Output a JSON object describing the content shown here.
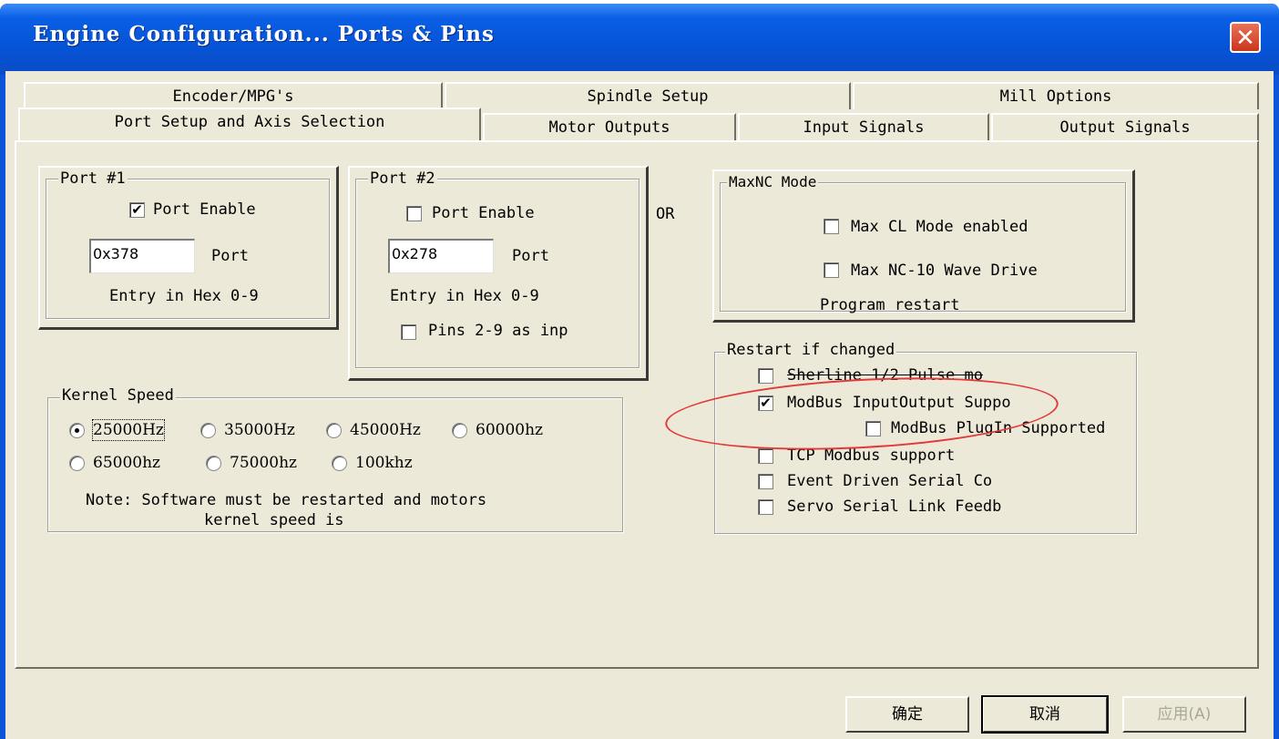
{
  "window": {
    "title": "Engine Configuration... Ports & Pins",
    "close_glyph": "✕"
  },
  "tabs": {
    "row1": [
      "Encoder/MPG's",
      "Spindle Setup",
      "Mill Options"
    ],
    "row2": [
      "Port Setup and Axis Selection",
      "Motor Outputs",
      "Input Signals",
      "Output Signals"
    ]
  },
  "port1": {
    "legend": "Port #1",
    "enable_label": "Port Enable",
    "enable_checked": true,
    "address": "0x378",
    "address_label": "Port",
    "hint": "Entry in Hex 0-9"
  },
  "port2": {
    "legend": "Port #2",
    "enable_label": "Port Enable",
    "enable_checked": false,
    "address": "0x278",
    "address_label": "Port",
    "hint": "Entry in Hex 0-9",
    "pins_label": "Pins 2-9 as inp",
    "pins_checked": false
  },
  "or_label": "OR",
  "maxnc": {
    "legend": "MaxNC Mode",
    "cl_label": "Max CL Mode enabled",
    "wave_label": "Max NC-10 Wave Drive",
    "restart_note": "Program restart"
  },
  "kernel": {
    "legend": "Kernel Speed",
    "options": [
      "25000Hz",
      "35000Hz",
      "45000Hz",
      "60000hz",
      "65000hz",
      "75000hz",
      "100khz"
    ],
    "selected": "25000Hz",
    "note_line1": "Note: Software must be restarted and motors",
    "note_line2": "kernel speed is"
  },
  "restart": {
    "legend": "Restart if changed",
    "sherline": "Sherline 1/2 Pulse mo",
    "modbus_io": "ModBus InputOutput Suppo",
    "modbus_io_checked": true,
    "modbus_plugin": "ModBus PlugIn Supported",
    "tcp_modbus": "TCP Modbus support",
    "event_serial": "Event Driven Serial Co",
    "servo_serial": "Servo Serial Link Feedb"
  },
  "buttons": {
    "ok": "确定",
    "cancel": "取消",
    "apply": "应用(A)"
  },
  "annotation_color": "#e23a3a"
}
